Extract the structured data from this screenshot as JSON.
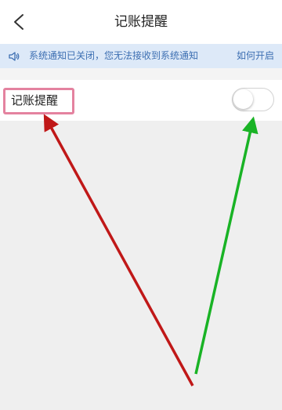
{
  "header": {
    "title": "记账提醒",
    "back_icon": "chevron-left-icon"
  },
  "notice": {
    "icon": "speaker-icon",
    "text": "系统通知已关闭，您无法接收到系统通知",
    "link": "如何开启"
  },
  "setting": {
    "label": "记账提醒",
    "enabled": false
  },
  "colors": {
    "notice_background": "#dde9f8",
    "notice_text": "#3d6fb2",
    "highlight_border": "#e4829f",
    "red_arrow": "#c01818",
    "green_arrow": "#19b325"
  }
}
